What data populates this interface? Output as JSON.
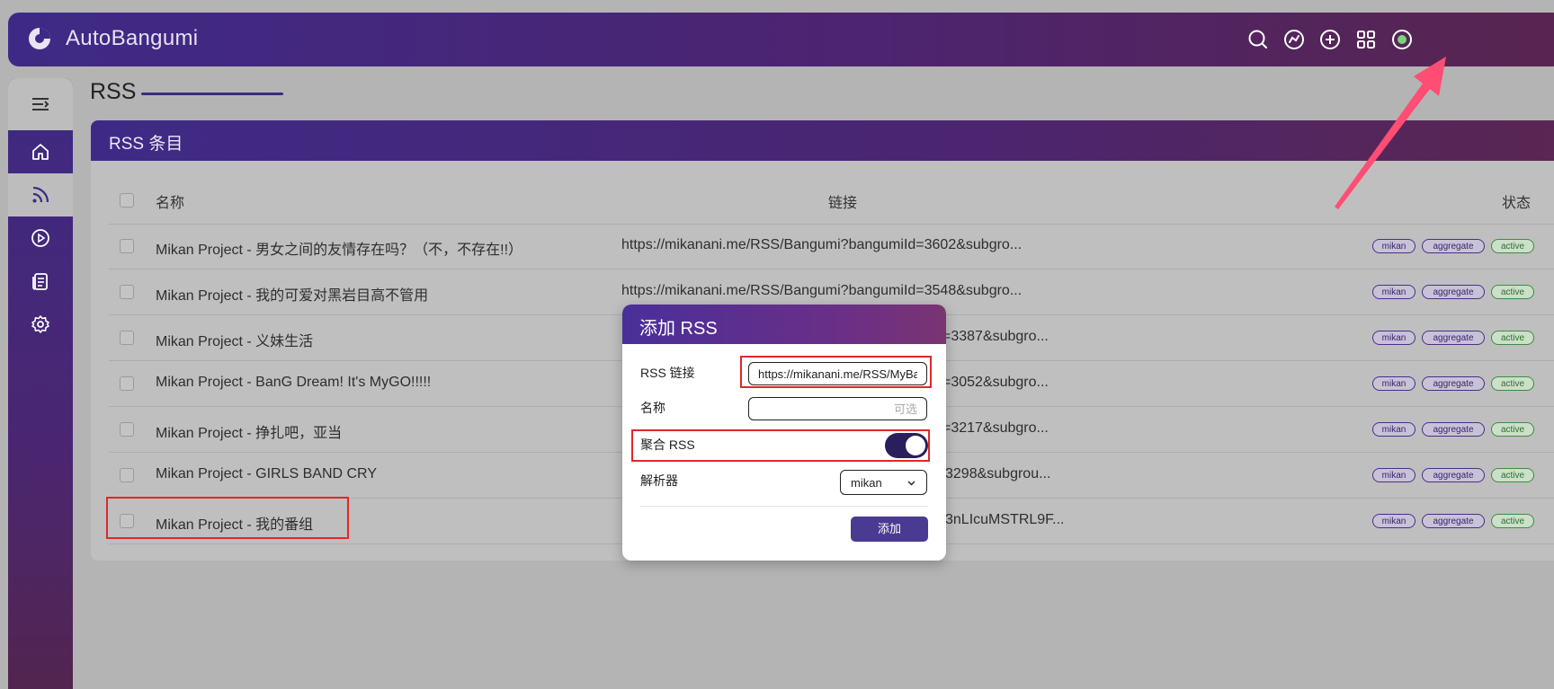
{
  "app": {
    "title": "AutoBangumi"
  },
  "header": {
    "icons": [
      "search-icon",
      "explore-icon",
      "add-circle-icon",
      "grid-icon",
      "status-icon"
    ]
  },
  "sidebar": {
    "items": [
      {
        "name": "home",
        "icon": "home-icon"
      },
      {
        "name": "rss",
        "icon": "rss-icon",
        "active": true
      },
      {
        "name": "player",
        "icon": "play-icon"
      },
      {
        "name": "log",
        "icon": "document-icon"
      },
      {
        "name": "config",
        "icon": "gear-icon"
      }
    ]
  },
  "page": {
    "title": "RSS"
  },
  "panel": {
    "title": "RSS 条目",
    "columns": {
      "name": "名称",
      "url": "链接",
      "status": "状态"
    },
    "rows": [
      {
        "name": "Mikan Project - 男女之间的友情存在吗？（不，不存在!!）",
        "url": "https://mikanani.me/RSS/Bangumi?bangumiId=3602&subgro...",
        "tags": [
          "mikan",
          "aggregate",
          "active"
        ]
      },
      {
        "name": "Mikan Project - 我的可爱对黑岩目高不管用",
        "url": "https://mikanani.me/RSS/Bangumi?bangumiId=3548&subgro...",
        "tags": [
          "mikan",
          "aggregate",
          "active"
        ]
      },
      {
        "name": "Mikan Project - 义妹生活",
        "url": "=3387&subgro...",
        "tags": [
          "mikan",
          "aggregate",
          "active"
        ]
      },
      {
        "name": "Mikan Project - BanG Dream! It's MyGO!!!!!",
        "url": "=3052&subgro...",
        "tags": [
          "mikan",
          "aggregate",
          "active"
        ]
      },
      {
        "name": "Mikan Project - 挣扎吧，亚当",
        "url": "=3217&subgro...",
        "tags": [
          "mikan",
          "aggregate",
          "active"
        ]
      },
      {
        "name": "Mikan Project - GIRLS BAND CRY",
        "url": "3298&subgrou...",
        "tags": [
          "mikan",
          "aggregate",
          "active"
        ]
      },
      {
        "name": "Mikan Project - 我的番组",
        "url": "3nLIcuMSTRL9F...",
        "tags": [
          "mikan",
          "aggregate",
          "active"
        ]
      }
    ]
  },
  "modal": {
    "title": "添加 RSS",
    "rss_label": "RSS 链接",
    "rss_value": "https://mikanani.me/RSS/MyBangumi",
    "name_label": "名称",
    "name_placeholder": "可选",
    "aggregate_label": "聚合 RSS",
    "aggregate_on": true,
    "parser_label": "解析器",
    "parser_value": "mikan",
    "submit_label": "添加"
  },
  "colors": {
    "brand": "#3e2a86",
    "accent": "#4a3a92",
    "highlight": "#e02828",
    "arrow": "#ff4d73",
    "active_tag": "#3f8b3f"
  }
}
